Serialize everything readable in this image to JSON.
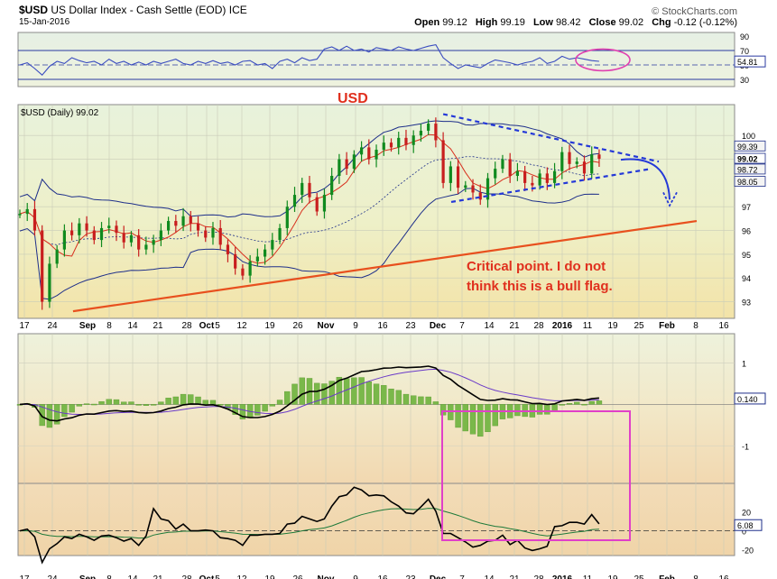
{
  "header": {
    "symbol": "$USD",
    "name": "US Dollar Index - Cash Settle (EOD) ICE",
    "date": "15-Jan-2016",
    "watermark": "© StockCharts.com",
    "open_label": "Open",
    "open": "99.12",
    "high_label": "High",
    "high": "99.19",
    "low_label": "Low",
    "low": "98.42",
    "close_label": "Close",
    "close": "99.02",
    "chg_label": "Chg",
    "chg": "-0.12 (-0.12%)"
  },
  "chart_data": [
    {
      "panel": "rsi",
      "type": "line",
      "ylim": [
        20,
        95
      ],
      "ticks": [
        "90",
        "70",
        "50",
        "30"
      ],
      "tick_values": [
        90,
        70,
        50,
        30
      ],
      "reference_lines": [
        70,
        30
      ],
      "last_value_label": "54.81",
      "last_value": 54.81,
      "annotation_ellipse": {
        "from_date": "Jan 4",
        "to_date": "Jan 19",
        "around_value": 57
      },
      "series": [
        {
          "values": [
            50,
            53,
            45,
            36,
            48,
            55,
            52,
            60,
            56,
            53,
            55,
            50,
            58,
            52,
            55,
            50,
            54,
            50,
            55,
            52,
            55,
            58,
            52,
            50,
            55,
            52,
            56,
            52,
            54,
            50,
            55,
            56,
            50,
            52,
            45,
            55,
            58,
            53,
            60,
            56,
            58,
            72,
            75,
            70,
            76,
            70,
            72,
            68,
            74,
            72,
            70,
            75,
            72,
            70,
            73,
            76,
            78,
            60,
            52,
            45,
            50,
            48,
            46,
            52,
            57,
            55,
            53,
            50,
            53,
            55,
            60,
            52,
            55,
            62,
            58,
            60,
            58,
            56,
            55
          ]
        }
      ]
    },
    {
      "panel": "price",
      "type": "candlestick",
      "title": "$USD (Daily) 99.02",
      "ylim": [
        92.3,
        101.3
      ],
      "yticks": [
        "100",
        "99",
        "97",
        "96",
        "95",
        "94",
        "93"
      ],
      "ytick_values": [
        100,
        99,
        97,
        96,
        95,
        94,
        93
      ],
      "xlabels": [
        "17",
        "24",
        "Sep",
        "8",
        "14",
        "21",
        "28",
        "Oct",
        "5",
        "12",
        "19",
        "26",
        "Nov",
        "9",
        "16",
        "23",
        "Dec",
        "7",
        "14",
        "21",
        "28",
        "2016",
        "11",
        "19",
        "25",
        "Feb",
        "8",
        "16"
      ],
      "xlabels_bold": [
        "Sep",
        "Oct",
        "Nov",
        "Dec",
        "2016",
        "Feb"
      ],
      "last_value_labels": [
        {
          "text": "99.39",
          "value": 99.39,
          "bold": false
        },
        {
          "text": "99.02",
          "value": 99.02,
          "bold": true
        },
        {
          "text": "98.72",
          "value": 98.72,
          "bold": false
        },
        {
          "text": "98.05",
          "value": 98.05,
          "bold": false
        }
      ],
      "closes": [
        96.7,
        96.9,
        96.0,
        93.0,
        94.6,
        95.2,
        96.0,
        95.8,
        96.3,
        96.0,
        95.6,
        96.1,
        96.2,
        95.9,
        95.5,
        95.8,
        95.2,
        95.4,
        95.6,
        96.0,
        96.4,
        96.2,
        96.6,
        96.3,
        96.0,
        95.7,
        96.1,
        95.4,
        95.0,
        94.4,
        94.1,
        94.7,
        94.9,
        95.2,
        95.6,
        96.1,
        97.0,
        97.5,
        98.0,
        97.4,
        96.8,
        97.5,
        98.3,
        99.0,
        98.6,
        99.2,
        99.5,
        99.0,
        99.4,
        99.7,
        99.5,
        99.9,
        99.6,
        100.0,
        100.2,
        100.5,
        99.8,
        98.0,
        98.7,
        97.8,
        97.9,
        97.6,
        97.3,
        98.2,
        98.6,
        99.0,
        98.3,
        98.5,
        98.0,
        97.9,
        98.4,
        98.0,
        98.5,
        99.3,
        98.8,
        98.9,
        98.4,
        99.2,
        99.02
      ],
      "annotations": [
        {
          "text": "USD",
          "color": "#e0301e",
          "bold": true
        },
        {
          "text": "Critical point. I do not",
          "color": "#e0301e",
          "bold": true
        },
        {
          "text": "think this is a bull flag.",
          "color": "#e0301e",
          "bold": true
        }
      ]
    },
    {
      "panel": "macd",
      "type": "histogram+line",
      "ylim": [
        -1.9,
        1.7
      ],
      "yticks": [
        "1",
        "-1"
      ],
      "ytick_values": [
        1,
        -1
      ],
      "last_value_label": "0.140",
      "last_value": 0.14,
      "annotation_box": {
        "from_date": "Dec 2",
        "to_date": "Jan 19",
        "color": "#e040c8"
      }
    },
    {
      "panel": "lower",
      "type": "line",
      "ylim": [
        -26,
        50
      ],
      "yticks": [
        "20",
        "0",
        "-20"
      ],
      "ytick_values": [
        20,
        0,
        -20
      ],
      "last_value_label": "6.08",
      "last_value": 6.08,
      "reference_lines": [
        0
      ]
    }
  ]
}
